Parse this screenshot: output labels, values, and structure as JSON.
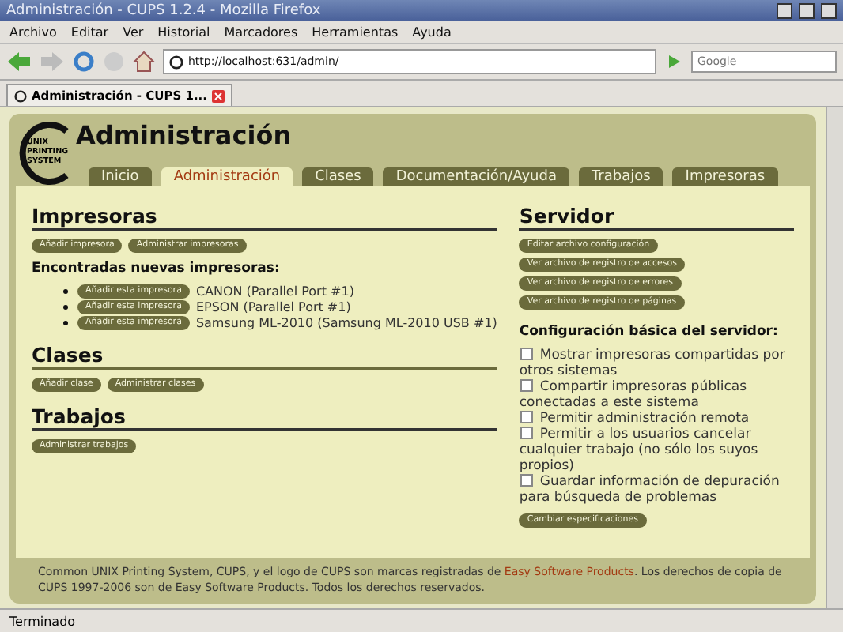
{
  "window": {
    "title": "Administración - CUPS 1.2.4 - Mozilla Firefox"
  },
  "menu": [
    "Archivo",
    "Editar",
    "Ver",
    "Historial",
    "Marcadores",
    "Herramientas",
    "Ayuda"
  ],
  "toolbar": {
    "url": "http://localhost:631/admin/",
    "search_placeholder": "Google"
  },
  "browser_tab": {
    "title": "Administración - CUPS 1..."
  },
  "page": {
    "logo_text": "UNIX PRINTING SYSTEM",
    "title": "Administración",
    "tabs": [
      {
        "label": "Inicio",
        "selected": false
      },
      {
        "label": "Administración",
        "selected": true
      },
      {
        "label": "Clases",
        "selected": false
      },
      {
        "label": "Documentación/Ayuda",
        "selected": false
      },
      {
        "label": "Trabajos",
        "selected": false
      },
      {
        "label": "Impresoras",
        "selected": false
      }
    ],
    "printers": {
      "heading": "Impresoras",
      "buttons": [
        "Añadir impresora",
        "Administrar impresoras"
      ],
      "found_label": "Encontradas nuevas impresoras:",
      "found": [
        {
          "button": "Añadir esta impresora",
          "name": "CANON (Parallel Port #1)"
        },
        {
          "button": "Añadir esta impresora",
          "name": "EPSON (Parallel Port #1)"
        },
        {
          "button": "Añadir esta impresora",
          "name": "Samsung ML-2010 (Samsung ML-2010 USB #1)"
        }
      ]
    },
    "classes": {
      "heading": "Clases",
      "buttons": [
        "Añadir clase",
        "Administrar clases"
      ]
    },
    "jobs": {
      "heading": "Trabajos",
      "buttons": [
        "Administrar trabajos"
      ]
    },
    "server": {
      "heading": "Servidor",
      "buttons": [
        "Editar archivo configuración",
        "Ver archivo de registro de accesos",
        "Ver archivo de registro de errores",
        "Ver archivo de registro de páginas"
      ],
      "settings_label": "Configuración básica del servidor:",
      "settings": [
        {
          "label": "Mostrar impresoras compartidas por otros sistemas",
          "checked": false
        },
        {
          "label": "Compartir impresoras públicas conectadas a este sistema",
          "checked": false
        },
        {
          "label": "Permitir administración remota",
          "checked": false
        },
        {
          "label": "Permitir a los usuarios cancelar cualquier trabajo (no sólo los suyos propios)",
          "checked": false
        },
        {
          "label": "Guardar información de depuración para búsqueda de problemas",
          "checked": false
        }
      ],
      "submit": "Cambiar especificaciones"
    },
    "footer": {
      "before": "Common UNIX Printing System, CUPS, y el logo de CUPS son marcas registradas de ",
      "link": "Easy Software Products",
      "after": ". Los derechos de copia de CUPS 1997-2006 son de Easy Software Products. Todos los derechos reservados."
    }
  },
  "status_bar": "Terminado"
}
